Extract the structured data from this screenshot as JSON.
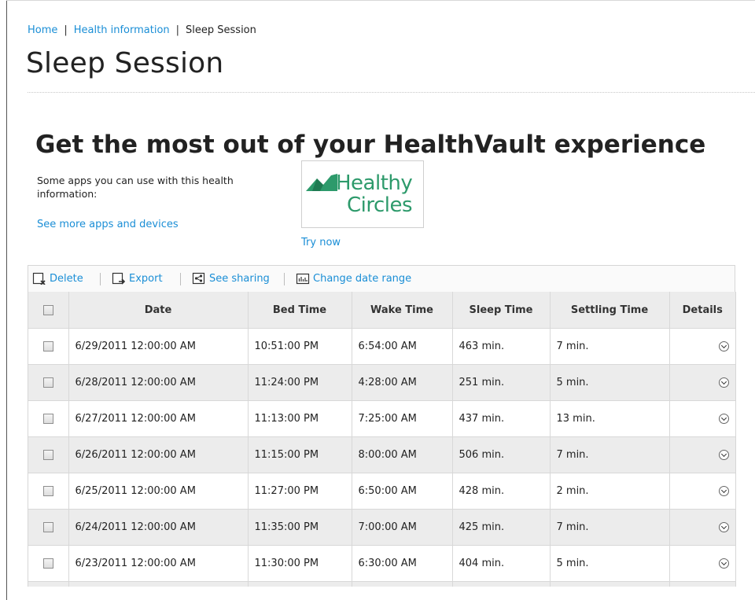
{
  "breadcrumb": {
    "home": "Home",
    "separator": "|",
    "section": "Health information",
    "current": "Sleep Session"
  },
  "page_title": "Sleep Session",
  "promo": {
    "heading": "Get the most out of your HealthVault experience",
    "text": "Some apps you can use with this health information:",
    "more_link": "See more apps and devices",
    "app_tile": {
      "line1": "Healthy",
      "line2": "Circles",
      "logo_color": "#2d9a6b"
    },
    "try_now": "Try now"
  },
  "toolbar": {
    "delete": "Delete",
    "export": "Export",
    "sharing": "See sharing",
    "date_range": "Change date range",
    "icons": [
      "delete-icon",
      "export-icon",
      "share-icon",
      "chart-icon"
    ]
  },
  "colors": {
    "link": "#1a8ed6",
    "row_alt": "#ececec",
    "header_bg": "#ececec"
  },
  "table": {
    "columns": [
      "Date",
      "Bed Time",
      "Wake Time",
      "Sleep Time",
      "Settling Time",
      "Details"
    ],
    "rows": [
      {
        "date": "6/29/2011 12:00:00 AM",
        "bed": "10:51:00 PM",
        "wake": "6:54:00 AM",
        "sleep": "463 min.",
        "settle": "7 min."
      },
      {
        "date": "6/28/2011 12:00:00 AM",
        "bed": "11:24:00 PM",
        "wake": "4:28:00 AM",
        "sleep": "251 min.",
        "settle": "5 min."
      },
      {
        "date": "6/27/2011 12:00:00 AM",
        "bed": "11:13:00 PM",
        "wake": "7:25:00 AM",
        "sleep": "437 min.",
        "settle": "13 min."
      },
      {
        "date": "6/26/2011 12:00:00 AM",
        "bed": "11:15:00 PM",
        "wake": "8:00:00 AM",
        "sleep": "506 min.",
        "settle": "7 min."
      },
      {
        "date": "6/25/2011 12:00:00 AM",
        "bed": "11:27:00 PM",
        "wake": "6:50:00 AM",
        "sleep": "428 min.",
        "settle": "2 min."
      },
      {
        "date": "6/24/2011 12:00:00 AM",
        "bed": "11:35:00 PM",
        "wake": "7:00:00 AM",
        "sleep": "425 min.",
        "settle": "7 min."
      },
      {
        "date": "6/23/2011 12:00:00 AM",
        "bed": "11:30:00 PM",
        "wake": "6:30:00 AM",
        "sleep": "404 min.",
        "settle": "5 min."
      }
    ]
  }
}
